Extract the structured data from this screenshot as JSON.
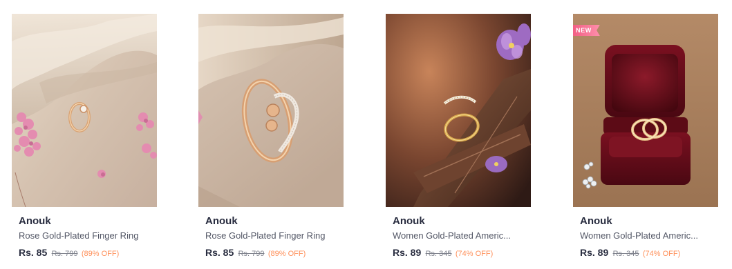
{
  "products": [
    {
      "brand": "Anouk",
      "name": "Rose Gold-Plated Finger Ring",
      "price": "Rs. 85",
      "mrp": "Rs. 799",
      "discount": "(89% OFF)",
      "badge": "",
      "image": "rose-gold-ring-on-beige-fabric-with-pink-flowers"
    },
    {
      "brand": "Anouk",
      "name": "Rose Gold-Plated Finger Ring",
      "price": "Rs. 85",
      "mrp": "Rs. 799",
      "discount": "(89% OFF)",
      "badge": "",
      "image": "rose-gold-ring-closeup-on-fabric"
    },
    {
      "brand": "Anouk",
      "name": "Women Gold-Plated Americ...",
      "price": "Rs. 89",
      "mrp": "Rs. 345",
      "discount": "(74% OFF)",
      "badge": "",
      "image": "gold-ring-on-wood-with-purple-flowers"
    },
    {
      "brand": "Anouk",
      "name": "Women Gold-Plated Americ...",
      "price": "Rs. 89",
      "mrp": "Rs. 345",
      "discount": "(74% OFF)",
      "badge": "NEW",
      "image": "gold-ring-in-red-velvet-box"
    }
  ],
  "colors": {
    "brand_text": "#282c3f",
    "name_text": "#535766",
    "mrp_text": "#7e818c",
    "discount_text": "#ff905a",
    "badge_bg": "#f25f85"
  }
}
